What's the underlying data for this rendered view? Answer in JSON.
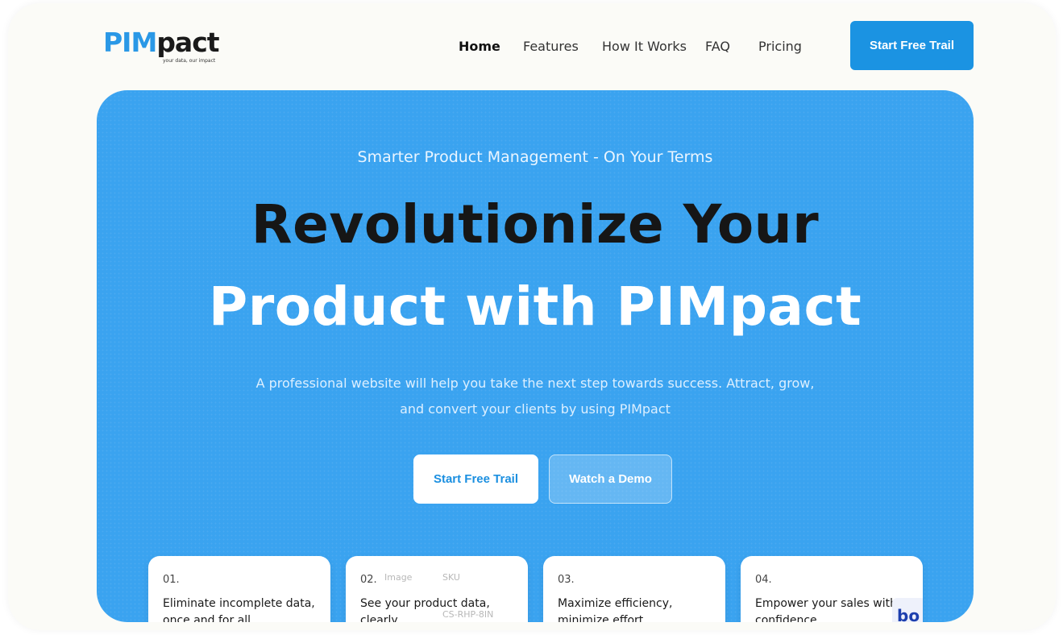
{
  "brand": {
    "name_part1": "PIM",
    "name_part2": "pact",
    "tagline": "your data, our impact"
  },
  "nav": {
    "items": [
      {
        "label": "Home",
        "active": true
      },
      {
        "label": "Features",
        "active": false
      },
      {
        "label": "How It Works",
        "active": false
      },
      {
        "label": "FAQ",
        "active": false
      },
      {
        "label": "Pricing",
        "active": false
      }
    ],
    "cta_label": "Start Free Trail"
  },
  "hero": {
    "eyebrow": "Smarter Product Management - On Your Terms",
    "headline_line1": "Revolutionize Your",
    "headline_line2": "Product with PIMpact",
    "subtext": "A professional website will help you take the next step towards success. Attract, grow, and convert your clients by using PIMpact",
    "primary_button": "Start Free Trail",
    "secondary_button": "Watch a Demo"
  },
  "cards": [
    {
      "num": "01.",
      "text": "Eliminate incomplete data, once and for all."
    },
    {
      "num": "02.",
      "text": "See your product data, clearly",
      "ghost": {
        "image": "Image",
        "sku": "SKU",
        "sku_value": "CS-RHP-8IN"
      }
    },
    {
      "num": "03.",
      "text": "Maximize efficiency, minimize effort."
    },
    {
      "num": "04.",
      "text": "Empower your sales with confidence.",
      "logo_text": "bo"
    }
  ],
  "colors": {
    "brand_blue": "#2a98e6",
    "hero_blue": "#3aa3f0",
    "cta_blue": "#1b93e2"
  }
}
